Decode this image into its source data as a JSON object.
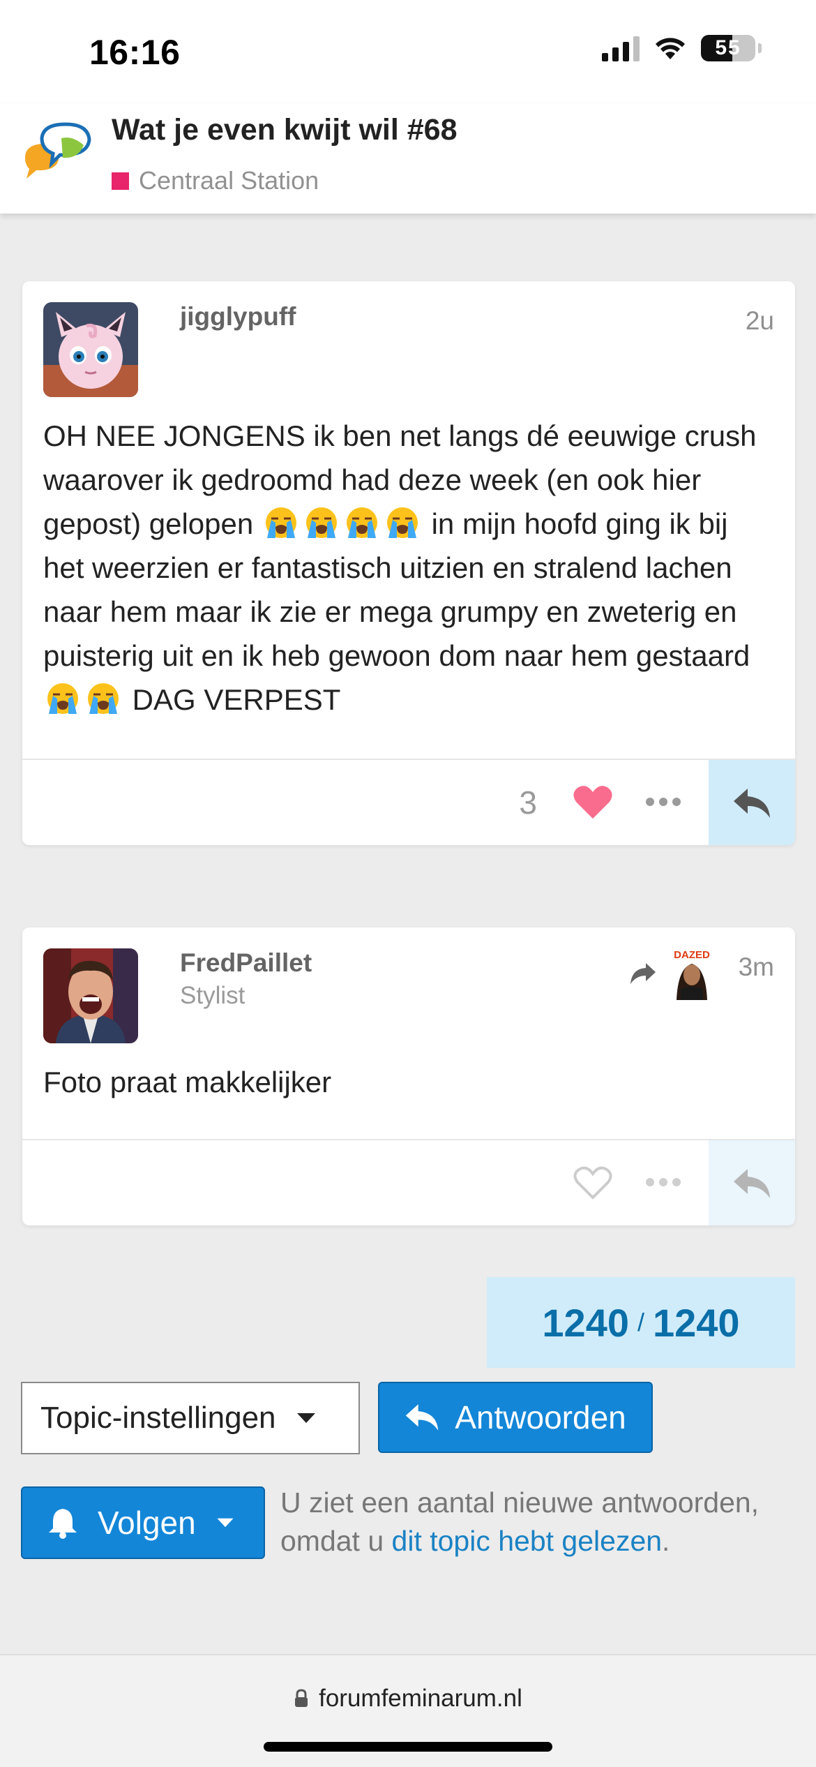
{
  "status_bar": {
    "time": "16:16",
    "battery": "55",
    "icons": [
      "signal-icon",
      "wifi-icon",
      "battery-icon"
    ]
  },
  "topic": {
    "title": "Wat je even kwijt wil #68",
    "category": "Centraal Station",
    "category_color": "#e8246a"
  },
  "posts": [
    {
      "username": "jigglypuff",
      "user_title": "",
      "age": "2u",
      "body_parts": [
        "OH NEE JONGENS ik ben net langs dé eeuwige crush waarover ik gedroomd had deze week (en ook hier gepost) gelopen ",
        " in mijn hoofd ging ik bij het weerzien er fantastisch uitzien en stralend lachen naar hem maar ik zie er mega grumpy en zweterig en puisterig uit en ik heb gewoon dom naar hem gestaard ",
        " DAG VERPEST"
      ],
      "emoji_name": "loudly-crying-face-emoji",
      "like_count": "3",
      "liked": true
    },
    {
      "username": "FredPaillet",
      "user_title": "Stylist",
      "age": "3m",
      "reply_to_label": "DAZED",
      "body": "Foto praat makkelijker",
      "like_count": "",
      "liked": false
    }
  ],
  "progress": {
    "current": "1240",
    "separator": "/",
    "total": "1240"
  },
  "controls": {
    "settings_label": "Topic-instellingen",
    "reply_label": "Antwoorden",
    "follow_label": "Volgen"
  },
  "notification": {
    "text_before": "U ziet een aantal nieuwe antwoorden, omdat u ",
    "link_text": "dit topic hebt gelezen",
    "text_after": "."
  },
  "browser": {
    "url": "forumfeminarum.nl"
  },
  "colors": {
    "accent": "#1386d8",
    "like": "#fa6c8d",
    "link": "#1a82c4"
  }
}
